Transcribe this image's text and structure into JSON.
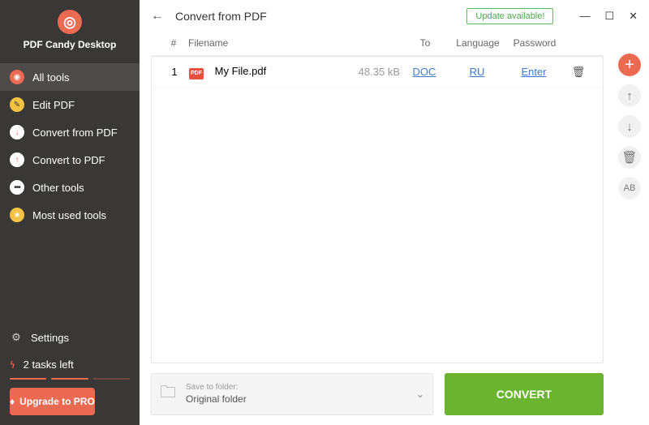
{
  "app": {
    "title": "PDF Candy Desktop"
  },
  "sidebar": {
    "items": [
      {
        "label": "All tools"
      },
      {
        "label": "Edit PDF"
      },
      {
        "label": "Convert from PDF"
      },
      {
        "label": "Convert to PDF"
      },
      {
        "label": "Other tools"
      },
      {
        "label": "Most used tools"
      }
    ],
    "settings": "Settings",
    "tasks": "2 tasks left",
    "upgrade": "Upgrade to PRO"
  },
  "header": {
    "title": "Convert from PDF",
    "update": "Update available!"
  },
  "table": {
    "head": {
      "num": "#",
      "filename": "Filename",
      "to": "To",
      "language": "Language",
      "password": "Password"
    },
    "rows": [
      {
        "num": "1",
        "filename": "My File.pdf",
        "size": "48.35 kB",
        "to": "DOC",
        "language": "RU",
        "password": "Enter"
      }
    ]
  },
  "footer": {
    "saveLabel": "Save to folder:",
    "saveValue": "Original folder",
    "convert": "CONVERT"
  },
  "tools": {
    "ab": "AB"
  }
}
